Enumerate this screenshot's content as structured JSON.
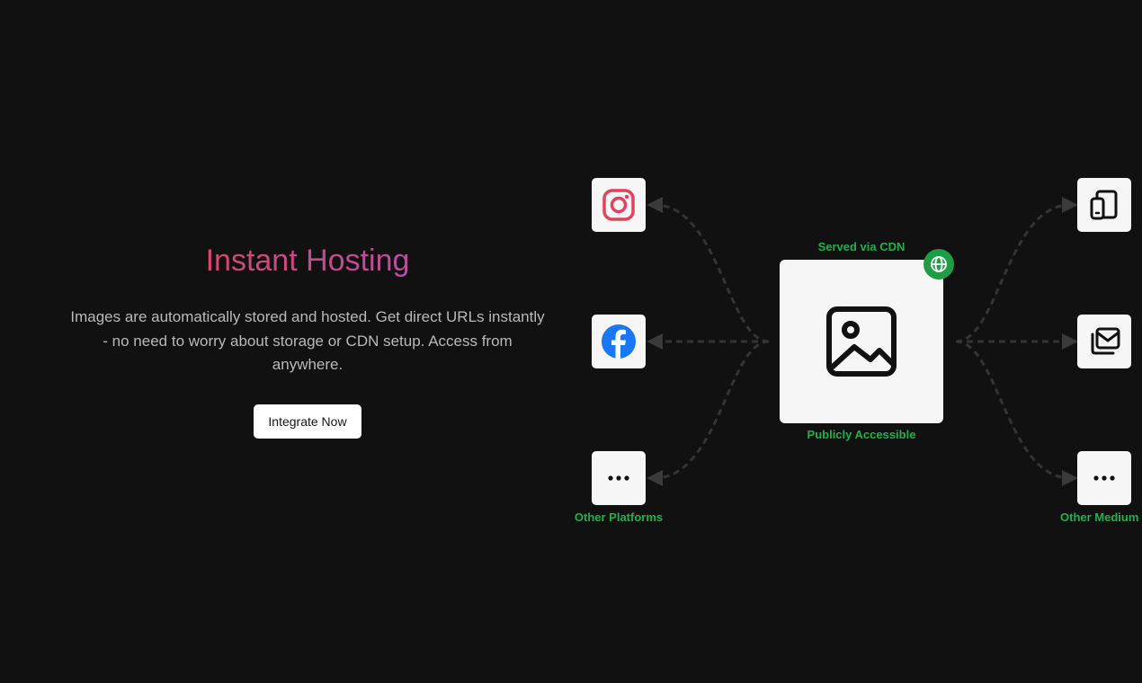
{
  "hero": {
    "title": "Instant Hosting",
    "description": "Images are automatically stored and hosted. Get direct URLs instantly - no need to worry about storage or CDN setup. Access from anywhere.",
    "cta_label": "Integrate Now",
    "title_gradient": [
      "#e5484d",
      "#c44a8c",
      "#a855c7"
    ]
  },
  "diagram": {
    "center_top_label": "Served via CDN",
    "center_bottom_label": "Publicly Accessible",
    "center_icon": "image-icon",
    "badge_icon": "globe-icon",
    "left_nodes": [
      {
        "icon": "instagram-icon",
        "label": ""
      },
      {
        "icon": "facebook-icon",
        "label": ""
      },
      {
        "icon": "more-icon",
        "label": "Other Platforms"
      }
    ],
    "right_nodes": [
      {
        "icon": "devices-icon",
        "label": ""
      },
      {
        "icon": "mail-stack-icon",
        "label": ""
      },
      {
        "icon": "more-icon",
        "label": "Other Medium"
      }
    ],
    "accent_color": "#22b04b",
    "background_color": "#111111"
  }
}
